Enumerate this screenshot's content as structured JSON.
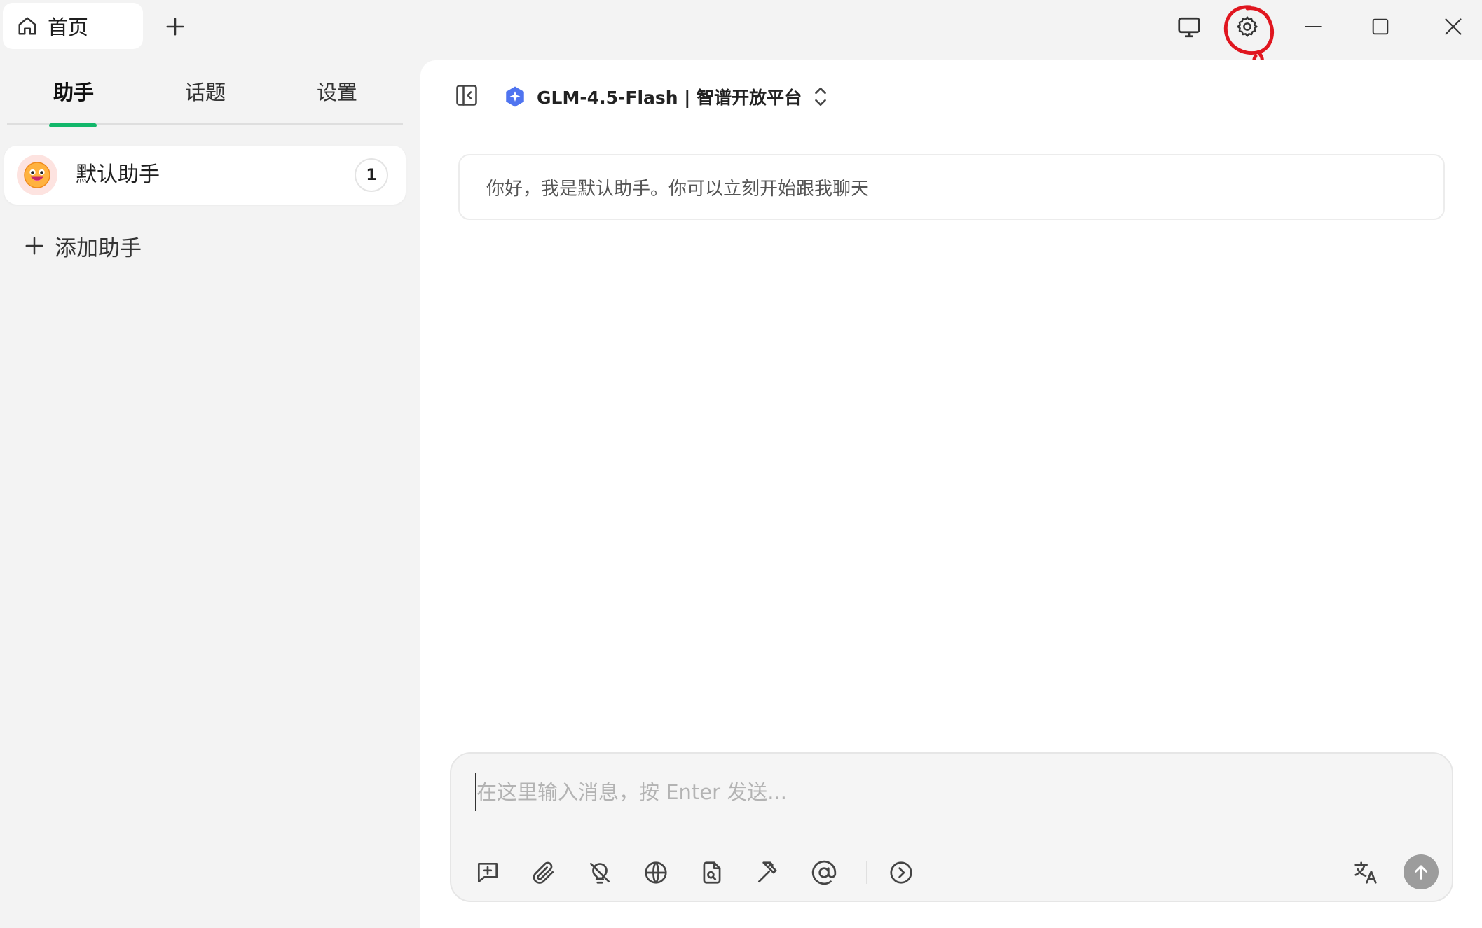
{
  "titlebar": {
    "home_tab_label": "首页",
    "icons": [
      "home-icon",
      "plus-icon",
      "monitor-icon",
      "gear-icon",
      "minimize-icon",
      "maximize-icon",
      "close-icon"
    ],
    "annotation_color": "#e0161f"
  },
  "sidebar": {
    "tabs": [
      {
        "label": "助手",
        "active": true
      },
      {
        "label": "话题",
        "active": false
      },
      {
        "label": "设置",
        "active": false
      }
    ],
    "accent_color": "#12b76a",
    "assistants": [
      {
        "name": "默认助手",
        "count": "1",
        "avatar": "smiling-face-avatar"
      }
    ],
    "add_assistant_label": "添加助手"
  },
  "chat": {
    "model_label": "GLM-4.5-Flash | 智谱开放平台",
    "greeting": "你好，我是默认助手。你可以立刻开始跟我聊天"
  },
  "input": {
    "value": "",
    "placeholder": "在这里输入消息，按 Enter 发送...",
    "tool_icons": [
      "new-topic-icon",
      "attachment-icon",
      "thinking-off-icon",
      "web-search-icon",
      "knowledge-file-icon",
      "tools-icon",
      "mention-icon",
      "more-icon"
    ],
    "right_icons": [
      "translate-icon",
      "send-icon"
    ]
  }
}
